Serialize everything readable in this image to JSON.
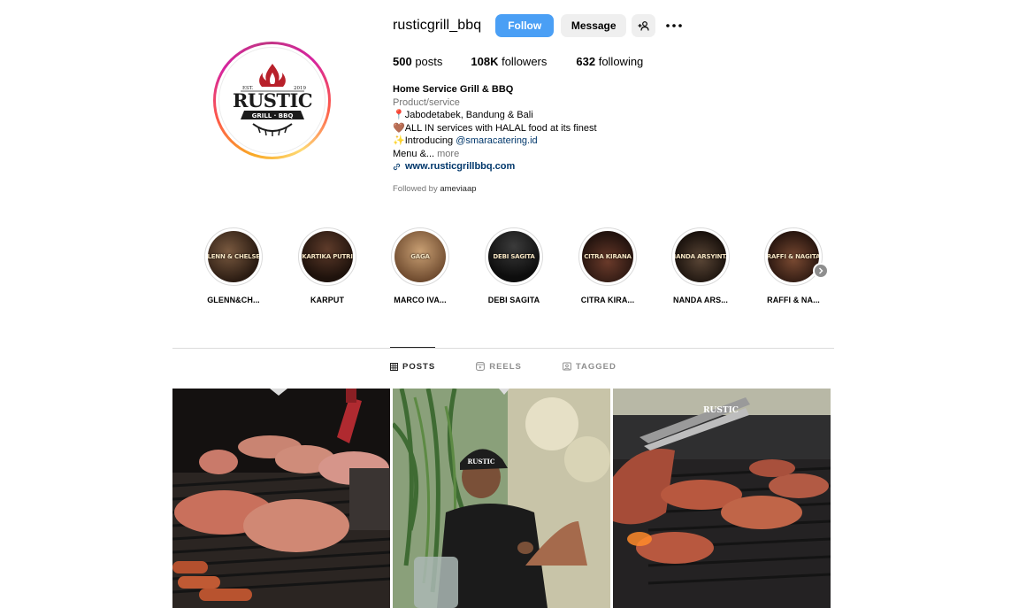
{
  "profile": {
    "username": "rusticgrill_bbq",
    "follow_label": "Follow",
    "message_label": "Message",
    "suggest_icon": "person-add-icon",
    "more_icon": "more-horizontal-icon"
  },
  "stats": {
    "posts_count": "500",
    "posts_label": " posts",
    "followers_count": "108K",
    "followers_label": " followers",
    "following_count": "632",
    "following_label": " following"
  },
  "bio": {
    "name": "Home Service Grill & BBQ",
    "category": "Product/service",
    "line1": "📍Jabodetabek, Bandung & Bali",
    "line2": "🤎ALL IN services with HALAL food at its finest",
    "line3_prefix": "✨Introducing ",
    "line3_mention": "@smaracatering.id",
    "line4_prefix": "Menu &... ",
    "line4_more": "more",
    "link": "www.rusticgrillbbq.com",
    "followed_by_prefix": "Followed by ",
    "followed_by_user": "ameviaap"
  },
  "logo": {
    "est": "EST.",
    "year": "2019",
    "word": "RUSTIC",
    "sub": "GRILL · BBQ"
  },
  "highlights": [
    {
      "label": "GLENN&CH...",
      "cover_text": "GLENN & CHELSEA"
    },
    {
      "label": "KARPUT",
      "cover_text": "KARTIKA PUTRI"
    },
    {
      "label": "MARCO IVA...",
      "cover_text": "GAGA"
    },
    {
      "label": "DEBI SAGITA",
      "cover_text": "DEBI SAGITA"
    },
    {
      "label": "CITRA KIRA...",
      "cover_text": "CITRA KIRANA"
    },
    {
      "label": "NANDA ARS...",
      "cover_text": "NANDA ARSYINTA"
    },
    {
      "label": "RAFFI & NA...",
      "cover_text": "RAFFI & NAGITA"
    }
  ],
  "tabs": [
    {
      "label": "POSTS",
      "icon": "grid-icon",
      "active": true
    },
    {
      "label": "REELS",
      "icon": "reels-icon",
      "active": false
    },
    {
      "label": "TAGGED",
      "icon": "tagged-icon",
      "active": false
    }
  ],
  "posts": [
    {
      "watermark": ""
    },
    {
      "watermark": ""
    },
    {
      "watermark": "RUSTIC"
    }
  ],
  "colors": {
    "follow_button": "#4a9ff5",
    "link": "#00376b",
    "logo_red": "#b8202a"
  }
}
